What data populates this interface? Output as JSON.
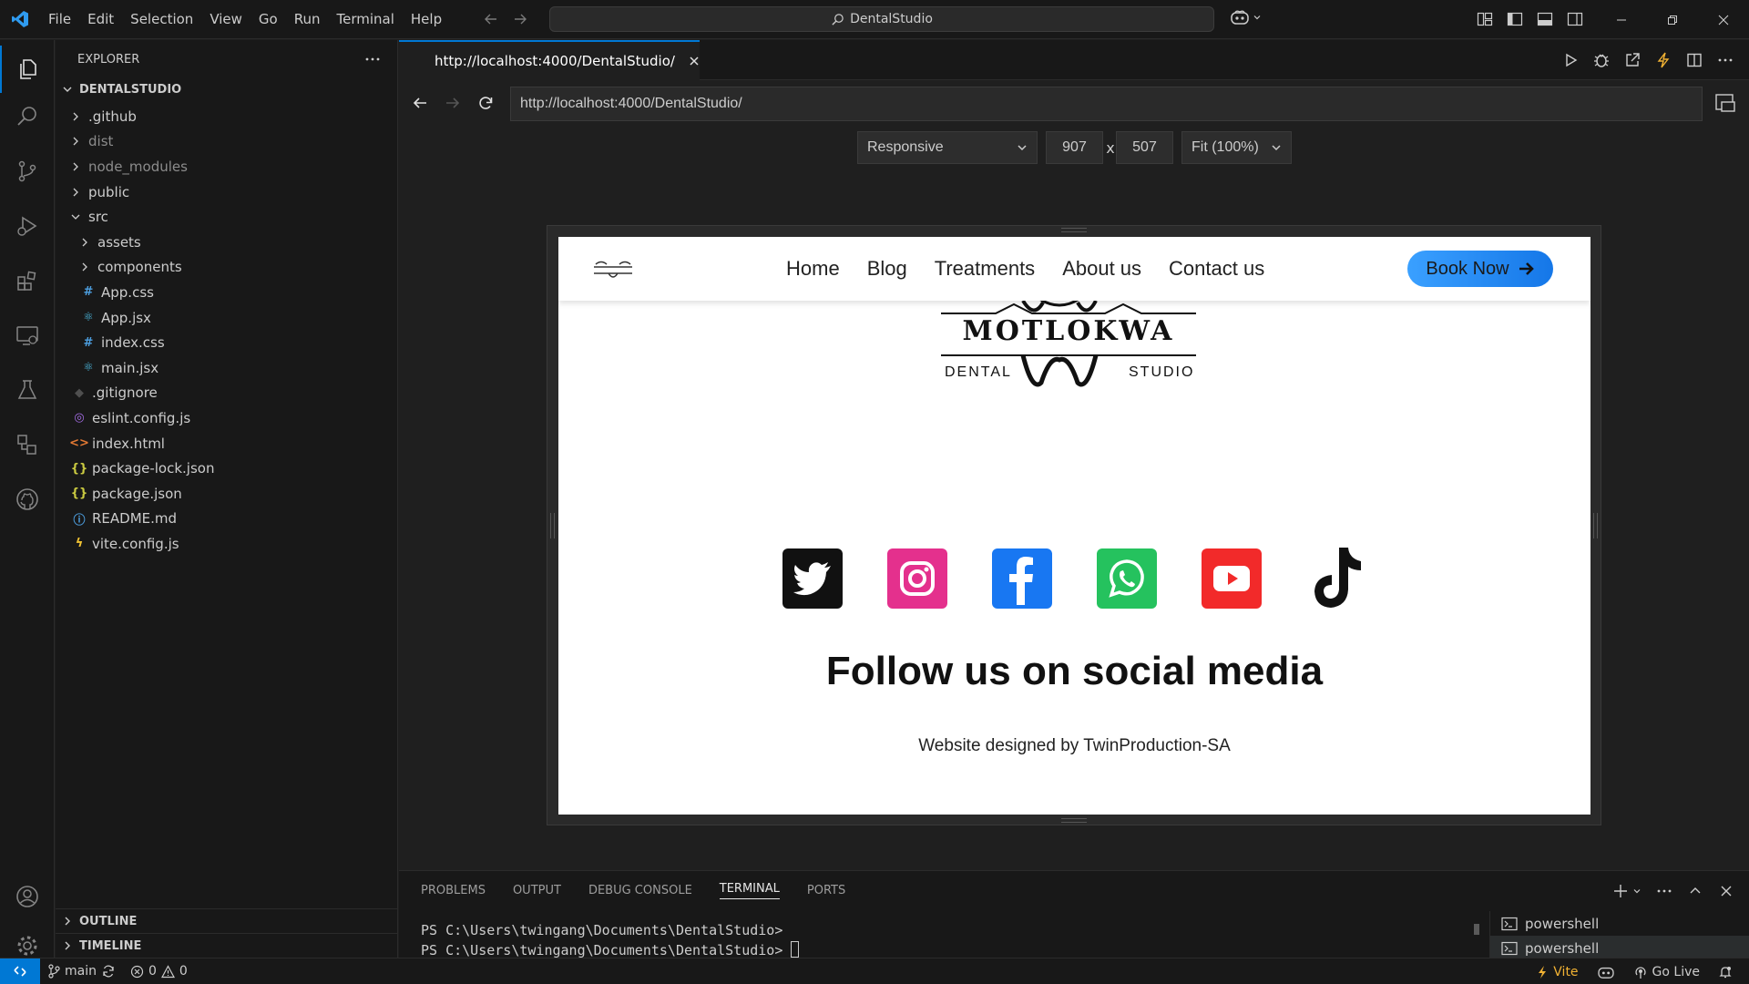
{
  "titlebar": {
    "menu": [
      "File",
      "Edit",
      "Selection",
      "View",
      "Go",
      "Run",
      "Terminal",
      "Help"
    ],
    "search_text": "DentalStudio"
  },
  "explorer": {
    "header": "EXPLORER",
    "root": "DENTALSTUDIO",
    "items": [
      {
        "label": ".github",
        "type": "folder",
        "level": 1,
        "expanded": false,
        "dim": false
      },
      {
        "label": "dist",
        "type": "folder",
        "level": 1,
        "expanded": false,
        "dim": true
      },
      {
        "label": "node_modules",
        "type": "folder",
        "level": 1,
        "expanded": false,
        "dim": true
      },
      {
        "label": "public",
        "type": "folder",
        "level": 1,
        "expanded": false,
        "dim": false
      },
      {
        "label": "src",
        "type": "folder",
        "level": 1,
        "expanded": true,
        "dim": false
      },
      {
        "label": "assets",
        "type": "folder",
        "level": 2,
        "expanded": false,
        "dim": false
      },
      {
        "label": "components",
        "type": "folder",
        "level": 2,
        "expanded": false,
        "dim": false
      },
      {
        "label": "App.css",
        "type": "css",
        "level": 2,
        "dim": false
      },
      {
        "label": "App.jsx",
        "type": "jsx",
        "level": 2,
        "dim": false
      },
      {
        "label": "index.css",
        "type": "css",
        "level": 2,
        "dim": false
      },
      {
        "label": "main.jsx",
        "type": "jsx",
        "level": 2,
        "dim": false
      },
      {
        "label": ".gitignore",
        "type": "git",
        "level": 1,
        "dim": false
      },
      {
        "label": "eslint.config.js",
        "type": "eslint",
        "level": 1,
        "dim": false
      },
      {
        "label": "index.html",
        "type": "html",
        "level": 1,
        "dim": false
      },
      {
        "label": "package-lock.json",
        "type": "json",
        "level": 1,
        "dim": false
      },
      {
        "label": "package.json",
        "type": "json",
        "level": 1,
        "dim": false
      },
      {
        "label": "README.md",
        "type": "info",
        "level": 1,
        "dim": false
      },
      {
        "label": "vite.config.js",
        "type": "vite",
        "level": 1,
        "dim": false
      }
    ],
    "outline": "OUTLINE",
    "timeline": "TIMELINE"
  },
  "editor": {
    "tab_title": "http://localhost:4000/DentalStudio/"
  },
  "browser": {
    "url": "http://localhost:4000/DentalStudio/",
    "device": "Responsive",
    "width": "907",
    "times": "x",
    "height": "507",
    "zoom": "Fit (100%)"
  },
  "site": {
    "nav": [
      "Home",
      "Blog",
      "Treatments",
      "About us",
      "Contact us"
    ],
    "book_button": "Book Now",
    "logo_name": "MOTLOKWA",
    "logo_left": "DENTAL",
    "logo_right": "STUDIO",
    "social": [
      "twitter-icon",
      "instagram-icon",
      "facebook-icon",
      "whatsapp-icon",
      "youtube-icon",
      "tiktok-icon"
    ],
    "follow_title": "Follow us on social media",
    "credit": "Website designed by TwinProduction-SA"
  },
  "panel": {
    "tabs": [
      "PROBLEMS",
      "OUTPUT",
      "DEBUG CONSOLE",
      "TERMINAL",
      "PORTS"
    ],
    "active_tab": "TERMINAL",
    "lines": [
      "PS C:\\Users\\twingang\\Documents\\DentalStudio>",
      "PS C:\\Users\\twingang\\Documents\\DentalStudio>"
    ],
    "terminals": [
      "powershell",
      "powershell"
    ]
  },
  "statusbar": {
    "branch": "main",
    "errors": "0",
    "warnings": "0",
    "vite": "Vite",
    "golive": "Go Live"
  },
  "colors": {
    "accent": "#0078d4",
    "book_button": "#1f8bff",
    "instagram": "#e4308d",
    "facebook": "#1877f2",
    "whatsapp": "#25c25e",
    "youtube": "#f22a2a"
  }
}
